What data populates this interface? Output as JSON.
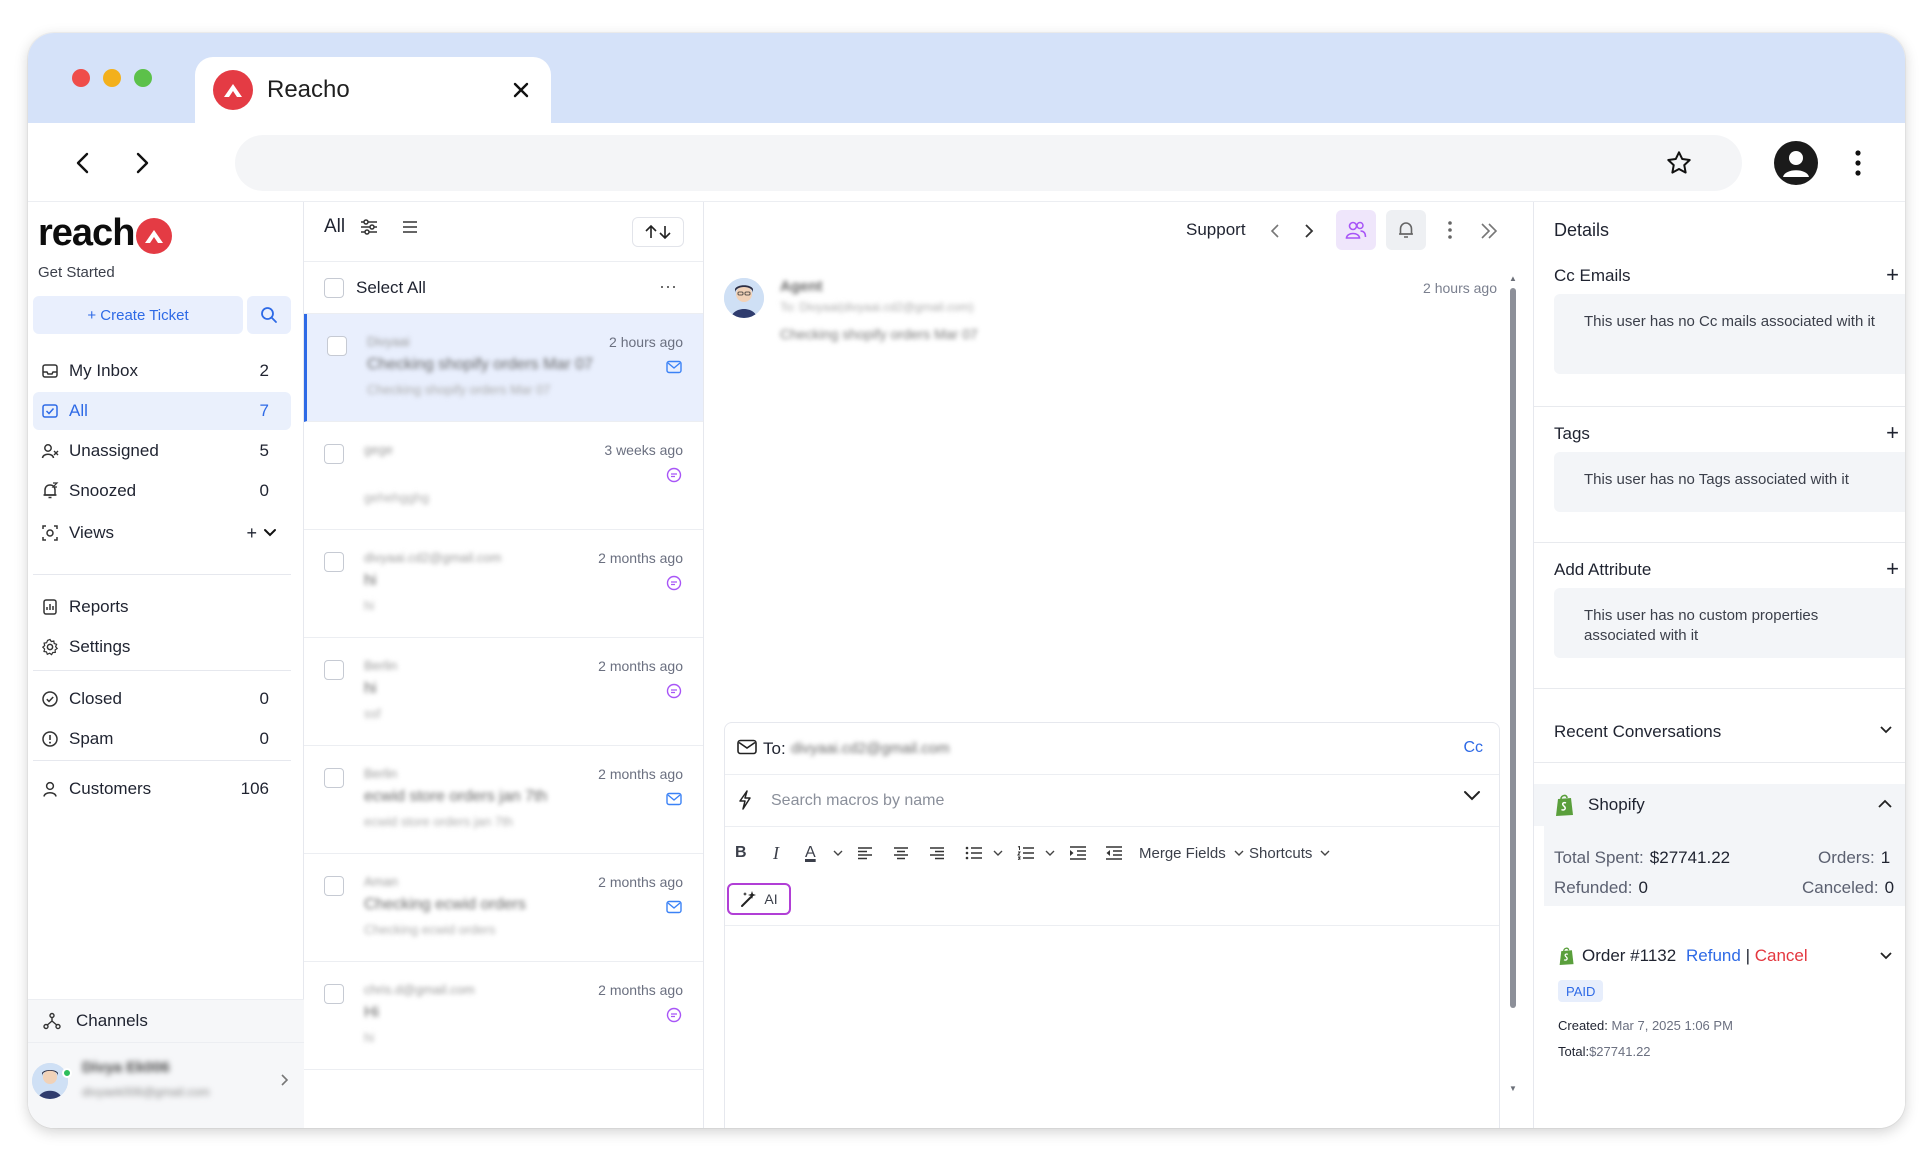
{
  "browser": {
    "tab_title": "Reacho",
    "back_label": "back",
    "forward_label": "forward"
  },
  "sidebar": {
    "brand": "reach",
    "get_started": "Get Started",
    "create_ticket": "+ Create Ticket",
    "nav": [
      {
        "label": "My Inbox",
        "count": "2"
      },
      {
        "label": "All",
        "count": "7"
      },
      {
        "label": "Unassigned",
        "count": "5"
      },
      {
        "label": "Snoozed",
        "count": "0"
      },
      {
        "label": "Views",
        "count": ""
      }
    ],
    "secondary": [
      {
        "label": "Reports"
      },
      {
        "label": "Settings"
      }
    ],
    "status": [
      {
        "label": "Closed",
        "count": "0"
      },
      {
        "label": "Spam",
        "count": "0"
      }
    ],
    "customers": {
      "label": "Customers",
      "count": "106"
    },
    "channels": "Channels",
    "user": {
      "name": "Divya Ek006",
      "email": "divyaek006@gmail.com"
    }
  },
  "conversation_list": {
    "filter_label": "All",
    "select_all": "Select All",
    "items": [
      {
        "who": "Divyaai",
        "subject": "Checking shopify orders Mar 07",
        "preview": "Checking shopify orders Mar 07",
        "time": "2 hours ago",
        "channel": "email"
      },
      {
        "who": "gege",
        "subject": "",
        "preview": "gehehgghg",
        "time": "3 weeks ago",
        "channel": "chat"
      },
      {
        "who": "divyaai.cd2@gmail.com",
        "subject": "hi",
        "preview": "hi",
        "time": "2 months ago",
        "channel": "chat"
      },
      {
        "who": "Berlin",
        "subject": "hi",
        "preview": "ssf",
        "time": "2 months ago",
        "channel": "chat"
      },
      {
        "who": "Berlin",
        "subject": "ecwid store orders jan 7th",
        "preview": "ecwid store orders jan 7th",
        "time": "2 months ago",
        "channel": "email"
      },
      {
        "who": "Aman",
        "subject": "Checking ecwid orders",
        "preview": "Checking ecwid orders",
        "time": "2 months ago",
        "channel": "email"
      },
      {
        "who": "chris.d@gmail.com",
        "subject": "Hi",
        "preview": "hi",
        "time": "2 months ago",
        "channel": "chat"
      }
    ]
  },
  "thread": {
    "inbox": "Support",
    "message": {
      "sender": "Agent",
      "to": "To: Divyaai(divyaai.cd2@gmail.com)",
      "body": "Checking shopify orders Mar 07",
      "time": "2 hours ago"
    },
    "composer": {
      "to_label": "To:",
      "to_value": "divyaai.cd2@gmail.com",
      "cc": "Cc",
      "macro_placeholder": "Search macros by name",
      "merge_fields": "Merge Fields",
      "shortcuts": "Shortcuts",
      "ai": "AI"
    }
  },
  "details": {
    "title": "Details",
    "cc_emails": {
      "title": "Cc Emails",
      "empty": "This user has no Cc mails associated with it"
    },
    "tags": {
      "title": "Tags",
      "empty": "This user has no Tags associated with it"
    },
    "attributes": {
      "title": "Add Attribute",
      "empty": "This user has no custom properties associated with it"
    },
    "recent_conversations": "Recent Conversations",
    "shopify": {
      "label": "Shopify",
      "total_spent_label": "Total Spent:",
      "total_spent": "$27741.22",
      "orders_label": "Orders:",
      "orders": "1",
      "refunded_label": "Refunded:",
      "refunded": "0",
      "canceled_label": "Canceled:",
      "canceled": "0"
    },
    "order": {
      "number": "Order #1132",
      "refund": "Refund",
      "separator": "|",
      "cancel": "Cancel",
      "status": "PAID",
      "created_label": "Created:",
      "created": "Mar 7, 2025 1:06 PM",
      "total_label": "Total:",
      "total": "$27741.22"
    }
  },
  "colors": {
    "accent": "#2e6ae6",
    "brand": "#e43b44",
    "ai_border": "#b13fd6",
    "titlebar": "#d5e2f9"
  }
}
